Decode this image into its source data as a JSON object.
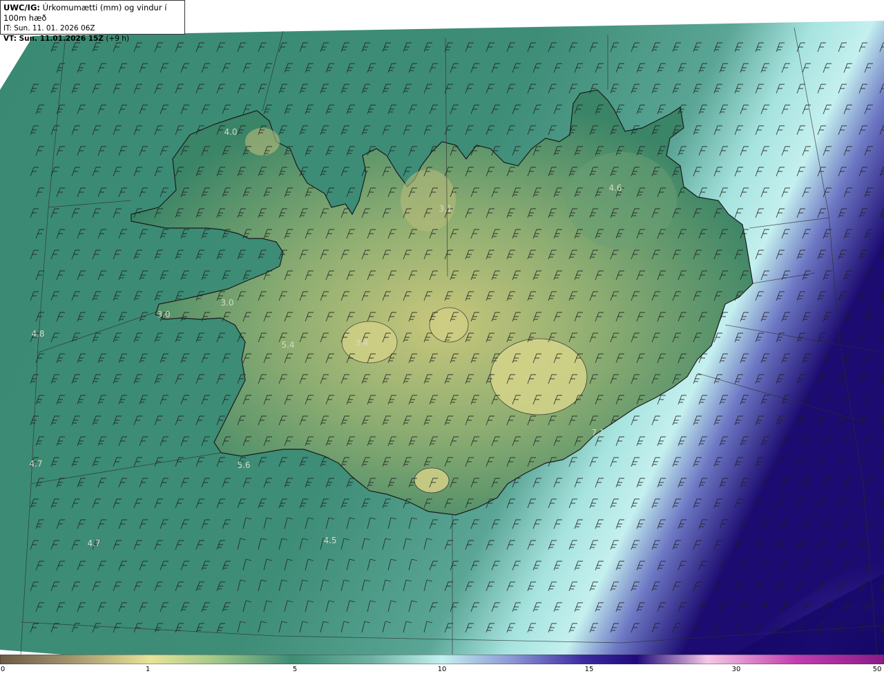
{
  "header": {
    "model": "UWC/IG:",
    "title": "Úrkomumætti (mm) og vindur í 100m hæð",
    "it_line": "IT: Sun. 11. 01. 2026 06Z",
    "vt_prefix": "VT: Sun. 11.01.2026 15Z",
    "vt_offset": "(+9 h)"
  },
  "colorbar": {
    "ticks": [
      {
        "label": "0",
        "value": 0
      },
      {
        "label": "1",
        "value": 1
      },
      {
        "label": "5",
        "value": 5
      },
      {
        "label": "10",
        "value": 10
      },
      {
        "label": "15",
        "value": 15
      },
      {
        "label": "30",
        "value": 30
      },
      {
        "label": "50",
        "value": 50
      }
    ],
    "colors": [
      "#6b5a45",
      "#b3a77a",
      "#e8e398",
      "#8fbf8d",
      "#3e8c74",
      "#6fb0a2",
      "#c4f0ef",
      "#8c95d4",
      "#3c2b9e",
      "#1f0a7a",
      "#f2a9d8",
      "#c03fae",
      "#8a1a88"
    ]
  },
  "map": {
    "value_labels": [
      "4.0",
      "4.6",
      "3.1",
      "3.0",
      "3.0",
      "4.8",
      "5.4",
      "3.4",
      "7.1",
      "4.7",
      "5.6",
      "4.7",
      "4.5"
    ],
    "colors": {
      "sea": "#3d8a74",
      "land_low": "#2f7a65",
      "land_high": "#c9c97a",
      "precip_high": "#bff0ee",
      "precip_max": "#1a0a6e"
    }
  }
}
